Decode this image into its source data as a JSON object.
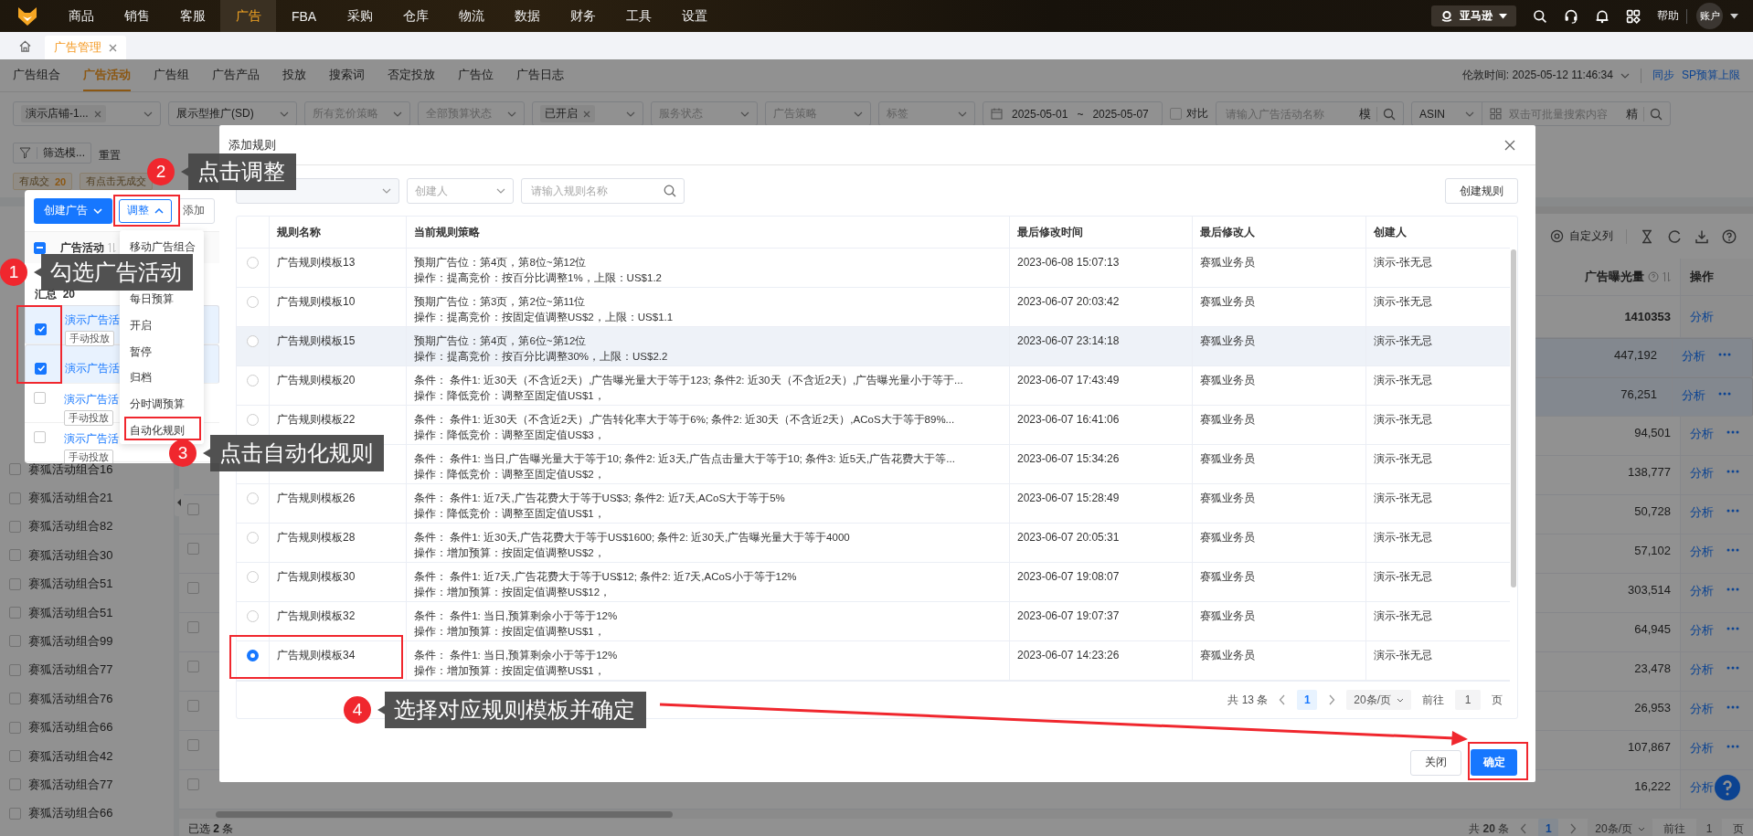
{
  "top_nav": {
    "menu": [
      {
        "label": "商品",
        "selected": false
      },
      {
        "label": "销售",
        "selected": false
      },
      {
        "label": "客服",
        "selected": false
      },
      {
        "label": "广告",
        "selected": true
      },
      {
        "label": "FBA",
        "selected": false
      },
      {
        "label": "采购",
        "selected": false
      },
      {
        "label": "仓库",
        "selected": false
      },
      {
        "label": "物流",
        "selected": false
      },
      {
        "label": "数据",
        "selected": false
      },
      {
        "label": "财务",
        "selected": false
      },
      {
        "label": "工具",
        "selected": false
      },
      {
        "label": "设置",
        "selected": false
      }
    ],
    "marketplace": "亚马逊",
    "help": "帮助",
    "account": "账户"
  },
  "page_tabs": [
    {
      "label": "广告管理",
      "selected": true
    }
  ],
  "sub_tabs": [
    {
      "label": "广告组合",
      "selected": false
    },
    {
      "label": "广告活动",
      "selected": true
    },
    {
      "label": "广告组",
      "selected": false
    },
    {
      "label": "广告产品",
      "selected": false
    },
    {
      "label": "投放",
      "selected": false
    },
    {
      "label": "搜索词",
      "selected": false
    },
    {
      "label": "否定投放",
      "selected": false
    },
    {
      "label": "广告位",
      "selected": false
    },
    {
      "label": "广告日志",
      "selected": false
    }
  ],
  "time_zone": "伦敦时间: 2025-05-12 11:46:34",
  "header_links": [
    "同步",
    "SP预算上限"
  ],
  "filters": [
    {
      "kind": "chip",
      "value": "演示店铺-1..."
    },
    {
      "kind": "value",
      "value": "展示型推广(SD)"
    },
    {
      "kind": "placeholder",
      "placeholder": "所有竞价策略"
    },
    {
      "kind": "placeholder",
      "placeholder": "全部预算状态"
    },
    {
      "kind": "chip",
      "value": "已开启"
    },
    {
      "kind": "placeholder",
      "placeholder": "服务状态"
    },
    {
      "kind": "placeholder",
      "placeholder": "广告策略"
    },
    {
      "kind": "placeholder",
      "placeholder": "标签"
    }
  ],
  "date_range": {
    "start": "2025-05-01",
    "separator": "~",
    "end": "2025-05-07"
  },
  "compare": {
    "label": "对比",
    "checked": false
  },
  "name_search": {
    "placeholder": "请输入广告活动名称",
    "mode": "模"
  },
  "asin_select": {
    "value": "ASIN"
  },
  "batch_search": {
    "placeholder": "双击可批量搜索内容",
    "mode": "精"
  },
  "filter_template": "筛选模...",
  "reset": "重置",
  "quick_tags": [
    {
      "label": "有成交",
      "count": "20"
    },
    {
      "label": "有点击无成交"
    }
  ],
  "sidebar": {
    "items": [
      {
        "label": "赛狐活动组合16",
        "checked": false
      },
      {
        "label": "赛狐活动组合21",
        "checked": false
      },
      {
        "label": "赛狐活动组合82",
        "checked": false
      },
      {
        "label": "赛狐活动组合30",
        "checked": false
      },
      {
        "label": "赛狐活动组合51",
        "checked": false
      },
      {
        "label": "赛狐活动组合51",
        "checked": false
      },
      {
        "label": "赛狐活动组合99",
        "checked": false
      },
      {
        "label": "赛狐活动组合77",
        "checked": false
      },
      {
        "label": "赛狐活动组合76",
        "checked": false
      },
      {
        "label": "赛狐活动组合66",
        "checked": false
      },
      {
        "label": "赛狐活动组合42",
        "checked": false
      },
      {
        "label": "赛狐活动组合77",
        "checked": false
      },
      {
        "label": "赛狐活动组合66",
        "checked": false
      }
    ]
  },
  "campaign_table": {
    "custom_columns": "自定义列",
    "columns": [
      "广告曝光量",
      "操作"
    ],
    "total": {
      "value": "1410353",
      "action": "分析"
    },
    "rows": [
      {
        "value": "447,192",
        "action": "分析",
        "selected": true
      },
      {
        "value": "76,251",
        "action": "分析",
        "selected": true
      },
      {
        "value": "94,501",
        "action": "分析",
        "selected": false
      },
      {
        "value": "138,777",
        "action": "分析",
        "selected": false
      },
      {
        "value": "50,728",
        "action": "分析",
        "selected": false,
        "checkbox": {
          "checked": false
        }
      },
      {
        "value": "57,102",
        "action": "分析",
        "selected": false,
        "checkbox": {
          "checked": false
        }
      },
      {
        "value": "303,514",
        "action": "分析",
        "selected": false,
        "checkbox": {
          "checked": false
        }
      },
      {
        "value": "64,945",
        "action": "分析",
        "selected": false,
        "checkbox": {
          "checked": false
        }
      },
      {
        "value": "23,478",
        "action": "分析",
        "selected": false,
        "checkbox": {
          "checked": false
        }
      },
      {
        "value": "26,953",
        "action": "分析",
        "selected": false,
        "checkbox": {
          "checked": false
        }
      },
      {
        "value": "107,867",
        "action": "分析",
        "selected": false,
        "checkbox": {
          "checked": false
        }
      },
      {
        "value": "16,222",
        "action": "分析",
        "selected": false,
        "checkbox": {
          "checked": false
        }
      }
    ]
  },
  "selection_footer": {
    "label": "已选",
    "count": "2",
    "unit": "条"
  },
  "pagination": {
    "total_prefix": "共",
    "total": "20",
    "total_unit": "条",
    "pages": [
      {
        "label": "1",
        "selected": true
      }
    ],
    "page_size": "20条/页",
    "goto": "前往",
    "goto_value": "1",
    "goto_unit": "页"
  },
  "campaign_popup": {
    "create_button": "创建广告",
    "adjust_button": "调整",
    "add_button": "添加",
    "header": {
      "label": "广告活动",
      "indeterminate": true
    },
    "summary": {
      "label": "汇总",
      "count": "20"
    },
    "rows": [
      {
        "name": "演示广告活",
        "tag": "手动投放",
        "checked": true
      },
      {
        "name": "演示广告活",
        "checked": true
      },
      {
        "name": "演示广告活",
        "tag": "手动投放",
        "checked": false
      },
      {
        "name": "演示广告活",
        "tag": "手动投放",
        "checked": false
      }
    ]
  },
  "adjust_menu": [
    "移动广告组合",
    "每日预算",
    "开启",
    "暂停",
    "归档",
    "分时调预算",
    "自动化规则"
  ],
  "modal": {
    "title": "添加规则",
    "creator_placeholder": "创建人",
    "name_placeholder": "请输入规则名称",
    "create_button": "创建规则",
    "columns": [
      "规则名称",
      "当前规则策略",
      "最后修改时间",
      "最后修改人",
      "创建人"
    ],
    "rows": [
      {
        "name": "广告规则模板13",
        "strategy": [
          "预期广告位：第4页，第8位~第12位",
          "操作：提高竞价：按百分比调整1%，上限：US$1.2"
        ],
        "time": "2023-06-08 15:07:13",
        "modifier": "赛狐业务员",
        "creator": "演示-张无忌",
        "selected": false,
        "highlighted": false
      },
      {
        "name": "广告规则模板10",
        "strategy": [
          "预期广告位：第3页，第2位~第11位",
          "操作：提高竞价：按固定值调整US$2，上限：US$1.1"
        ],
        "time": "2023-06-07 20:03:42",
        "modifier": "赛狐业务员",
        "creator": "演示-张无忌",
        "selected": false,
        "highlighted": false
      },
      {
        "name": "广告规则模板15",
        "strategy": [
          "预期广告位：第4页，第6位~第12位",
          "操作：提高竞价：按百分比调整30%，上限：US$2.2"
        ],
        "time": "2023-06-07 23:14:18",
        "modifier": "赛狐业务员",
        "creator": "演示-张无忌",
        "selected": false,
        "highlighted": true
      },
      {
        "name": "广告规则模板20",
        "strategy": [
          "条件： 条件1: 近30天（不含近2天）,广告曝光量大于等于123; 条件2: 近30天（不含近2天）,广告曝光量小于等于...",
          "操作：降低竞价：调整至固定值US$1，"
        ],
        "time": "2023-06-07 17:43:49",
        "modifier": "赛狐业务员",
        "creator": "演示-张无忌",
        "selected": false,
        "highlighted": false
      },
      {
        "name": "广告规则模板22",
        "strategy": [
          "条件： 条件1: 近30天（不含近2天）,广告转化率大于等于6%; 条件2: 近30天（不含近2天）,ACoS大于等于89%...",
          "操作：降低竞价：调整至固定值US$3，"
        ],
        "time": "2023-06-07 16:41:06",
        "modifier": "赛狐业务员",
        "creator": "演示-张无忌",
        "selected": false,
        "highlighted": false
      },
      {
        "strategy": [
          "条件： 条件1: 当日,广告曝光量大于等于10; 条件2: 近3天,广告点击量大于等于10; 条件3: 近5天,广告花费大于等...",
          "操作：降低竞价：调整至固定值US$2，"
        ],
        "time": "2023-06-07 15:34:26",
        "modifier": "赛狐业务员",
        "creator": "演示-张无忌",
        "highlighted": false
      },
      {
        "name": "广告规则模板26",
        "strategy": [
          "条件： 条件1: 近7天,广告花费大于等于US$3; 条件2: 近7天,ACoS大于等于5%",
          "操作：降低竞价：调整至固定值US$1，"
        ],
        "time": "2023-06-07 15:28:49",
        "modifier": "赛狐业务员",
        "creator": "演示-张无忌",
        "selected": false,
        "highlighted": false
      },
      {
        "name": "广告规则模板28",
        "strategy": [
          "条件： 条件1: 近30天,广告花费大于等于US$1600; 条件2: 近30天,广告曝光量大于等于4000",
          "操作：增加预算：按固定值调整US$2，"
        ],
        "time": "2023-06-07 20:05:31",
        "modifier": "赛狐业务员",
        "creator": "演示-张无忌",
        "selected": false,
        "highlighted": false
      },
      {
        "name": "广告规则模板30",
        "strategy": [
          "条件： 条件1: 近7天,广告花费大于等于US$12; 条件2: 近7天,ACoS小于等于12%",
          "操作：增加预算：按固定值调整US$12，"
        ],
        "time": "2023-06-07 19:08:07",
        "modifier": "赛狐业务员",
        "creator": "演示-张无忌",
        "selected": false,
        "highlighted": false
      },
      {
        "name": "广告规则模板32",
        "strategy": [
          "条件： 条件1: 当日,预算剩余小于等于12%",
          "操作：增加预算：按固定值调整US$1，"
        ],
        "time": "2023-06-07 19:07:37",
        "modifier": "赛狐业务员",
        "creator": "演示-张无忌",
        "selected": false,
        "highlighted": false
      },
      {
        "name": "广告规则模板34",
        "strategy": [
          "条件： 条件1: 当日,预算剩余小于等于12%",
          "操作：增加预算：按固定值调整US$1，"
        ],
        "time": "2023-06-07 14:23:26",
        "modifier": "赛狐业务员",
        "creator": "演示-张无忌",
        "selected": true,
        "highlighted": false
      }
    ],
    "pagination": {
      "total_prefix": "共",
      "total": "13",
      "total_unit": "条",
      "pages": [
        {
          "label": "1",
          "selected": true
        }
      ],
      "page_size": "20条/页",
      "goto": "前往",
      "goto_value": "1",
      "goto_unit": "页"
    },
    "close_button": "关闭",
    "confirm_button": "确定"
  },
  "annotations": [
    {
      "number": "1",
      "text": "勾选广告活动"
    },
    {
      "number": "2",
      "text": "点击调整"
    },
    {
      "number": "3",
      "text": "点击自动化规则"
    },
    {
      "number": "4",
      "text": "选择对应规则模板并确定"
    }
  ]
}
